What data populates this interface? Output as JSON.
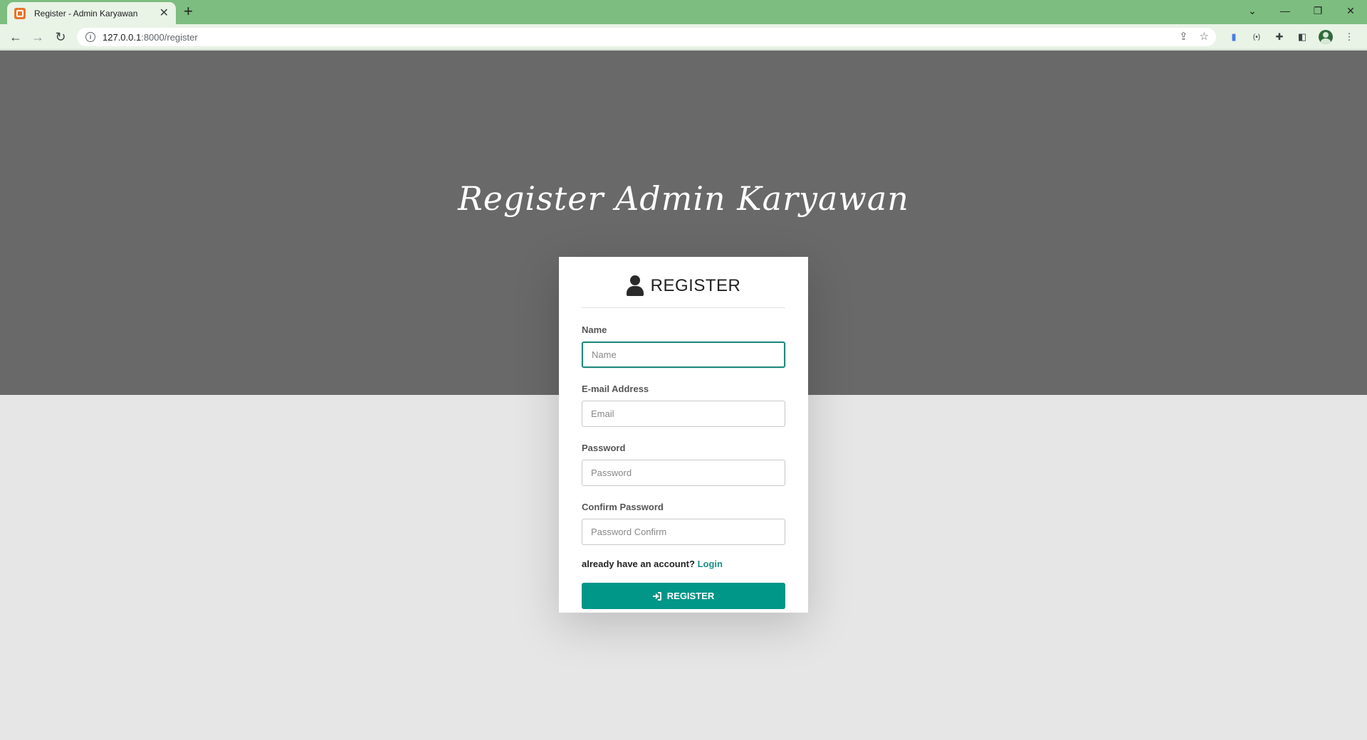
{
  "browser": {
    "tab_title": "Register - Admin Karyawan",
    "tab_close": "✕",
    "new_tab": "+",
    "url_host": "127.0.0.1",
    "url_path": ":8000/register",
    "window_controls": {
      "dropdown": "⌄",
      "minimize": "—",
      "restore": "❐",
      "close": "✕"
    },
    "nav": {
      "back": "←",
      "forward": "→",
      "reload": "↻"
    }
  },
  "page": {
    "heading": "Register Admin Karyawan"
  },
  "form": {
    "title": "REGISTER",
    "fields": [
      {
        "label": "Name",
        "placeholder": "Name",
        "value": ""
      },
      {
        "label": "E-mail Address",
        "placeholder": "Email",
        "value": ""
      },
      {
        "label": "Password",
        "placeholder": "Password",
        "value": ""
      },
      {
        "label": "Confirm Password",
        "placeholder": "Password Confirm",
        "value": ""
      }
    ],
    "login_prompt": "already have an account?",
    "login_link": "Login",
    "submit_label": "REGISTER"
  },
  "colors": {
    "tabbar": "#7dbd7f",
    "hero": "#696969",
    "accent": "#009688"
  }
}
